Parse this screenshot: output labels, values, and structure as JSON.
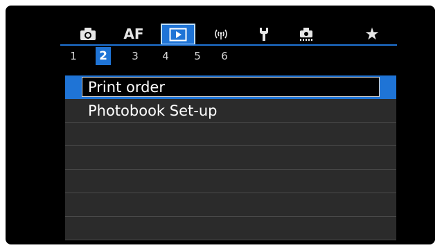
{
  "tabs": [
    {
      "icon": "camera-icon",
      "label": ""
    },
    {
      "icon": "af-text",
      "label": "AF"
    },
    {
      "icon": "playback-icon",
      "label": ""
    },
    {
      "icon": "wireless-icon",
      "label": ""
    },
    {
      "icon": "wrench-icon",
      "label": ""
    },
    {
      "icon": "custom-function-icon",
      "label": ""
    },
    {
      "icon": "star-icon",
      "label": "★"
    }
  ],
  "active_tab": "playback-icon",
  "subtabs": [
    "1",
    "2",
    "3",
    "4",
    "5",
    "6"
  ],
  "active_subtab": "2",
  "menu": {
    "items": [
      "Print order",
      "Photobook Set-up",
      "",
      "",
      "",
      "",
      ""
    ],
    "selected": "Print order"
  },
  "colors": {
    "accent": "#1f74d6",
    "row": "#2b2b2b",
    "background": "#000000"
  }
}
